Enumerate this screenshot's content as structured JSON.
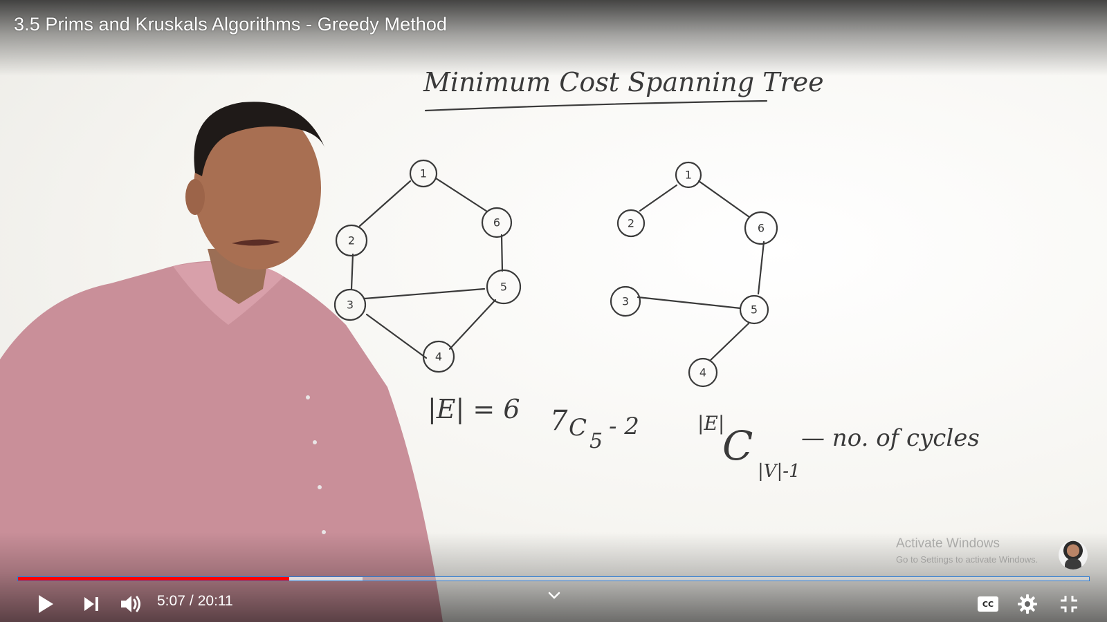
{
  "video": {
    "title": "3.5 Prims and Kruskals Algorithms - Greedy Method",
    "time": {
      "current": "5:07",
      "separator": "/",
      "duration": "20:11"
    },
    "progress": {
      "played_fraction": 0.253,
      "buffered_fraction": 0.322
    }
  },
  "whiteboard": {
    "heading": "Minimum Cost Spanning Tree",
    "graph_left_nodes": [
      "1",
      "2",
      "3",
      "4",
      "5",
      "6"
    ],
    "graph_right_nodes": [
      "1",
      "2",
      "3",
      "4",
      "5",
      "6"
    ],
    "formula_edges": "|E| = 6",
    "formula_combination_base": "7",
    "formula_combination_c": "C",
    "formula_combination_sub": "5",
    "formula_combination_minus": "- 2",
    "formula_general_sup": "|E|",
    "formula_general_c": "C",
    "formula_general_sub": "|V|-1",
    "formula_general_tail": "— no. of cycles"
  },
  "overlay": {
    "watermark_title": "Activate Windows",
    "watermark_subtitle": "Go to Settings to activate Windows."
  },
  "controls": {
    "icons": {
      "play": "play-icon",
      "next": "next-icon",
      "volume": "volume-icon",
      "chevron": "chevron-down-icon",
      "captions": "closed-captions-icon",
      "settings": "gear-icon",
      "exit_fullscreen": "exit-fullscreen-icon"
    },
    "accent_color": "#ff0000"
  }
}
